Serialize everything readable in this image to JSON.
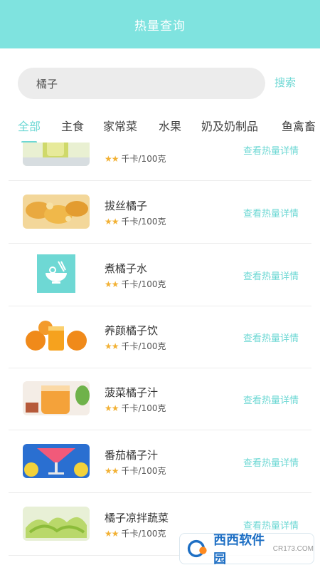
{
  "header": {
    "title": "热量查询"
  },
  "search": {
    "value": "橘子",
    "button_label": "搜索"
  },
  "tabs": [
    {
      "label": "全部",
      "active": true
    },
    {
      "label": "主食",
      "active": false
    },
    {
      "label": "家常菜",
      "active": false
    },
    {
      "label": "水果",
      "active": false
    },
    {
      "label": "奶及奶制品",
      "active": false
    },
    {
      "label": "鱼禽畜",
      "active": false
    }
  ],
  "items": [
    {
      "name": "",
      "unit": "千卡/100克",
      "stars": "★★",
      "detail_label": "查看热量详情"
    },
    {
      "name": "拔丝橘子",
      "unit": "千卡/100克",
      "stars": "★★",
      "detail_label": "查看热量详情"
    },
    {
      "name": "煮橘子水",
      "unit": "千卡/100克",
      "stars": "★★",
      "detail_label": "查看热量详情"
    },
    {
      "name": "养颜橘子饮",
      "unit": "千卡/100克",
      "stars": "★★",
      "detail_label": "查看热量详情"
    },
    {
      "name": "菠菜橘子汁",
      "unit": "千卡/100克",
      "stars": "★★",
      "detail_label": "查看热量详情"
    },
    {
      "name": "番茄橘子汁",
      "unit": "千卡/100克",
      "stars": "★★",
      "detail_label": "查看热量详情"
    },
    {
      "name": "橘子凉拌蔬菜",
      "unit": "千卡/100克",
      "stars": "★★",
      "detail_label": "查看热量详情"
    }
  ],
  "watermark": {
    "text": "西西软件园",
    "sub": "CR173.COM"
  },
  "colors": {
    "accent": "#6ed8d4",
    "header": "#7fe3df",
    "star": "#f2b134"
  }
}
